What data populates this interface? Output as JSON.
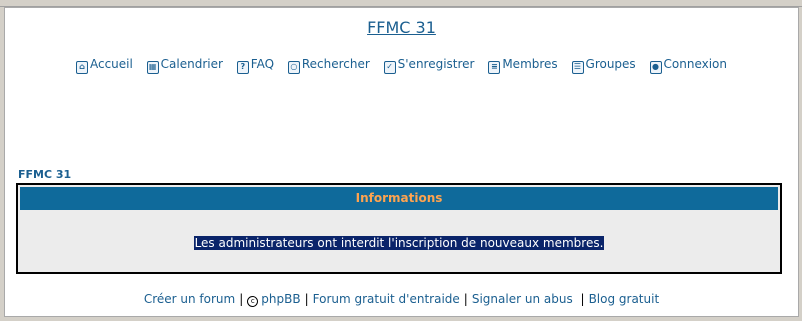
{
  "site": {
    "title": "FFMC 31"
  },
  "nav": {
    "items": [
      {
        "label": "Accueil",
        "icon": "home-icon"
      },
      {
        "label": "Calendrier",
        "icon": "calendar-icon"
      },
      {
        "label": "FAQ",
        "icon": "faq-icon"
      },
      {
        "label": "Rechercher",
        "icon": "search-icon"
      },
      {
        "label": "S'enregistrer",
        "icon": "register-icon"
      },
      {
        "label": "Membres",
        "icon": "members-icon"
      },
      {
        "label": "Groupes",
        "icon": "groups-icon"
      },
      {
        "label": "Connexion",
        "icon": "login-icon"
      }
    ]
  },
  "breadcrumb": {
    "label": "FFMC 31"
  },
  "panel": {
    "header": "Informations",
    "message": "Les administrateurs ont interdit l'inscription de nouveaux membres."
  },
  "footer": {
    "create_forum": "Créer un forum",
    "phpbb": "phpBB",
    "help_forum": "Forum gratuit d'entraide",
    "report_abuse": "Signaler un abus",
    "free_blog": "Blog gratuit"
  },
  "colors": {
    "link": "#1b5f90",
    "header_bg": "#0f6a9b",
    "header_text": "#ffa34f",
    "selection_bg": "#0a246a"
  }
}
